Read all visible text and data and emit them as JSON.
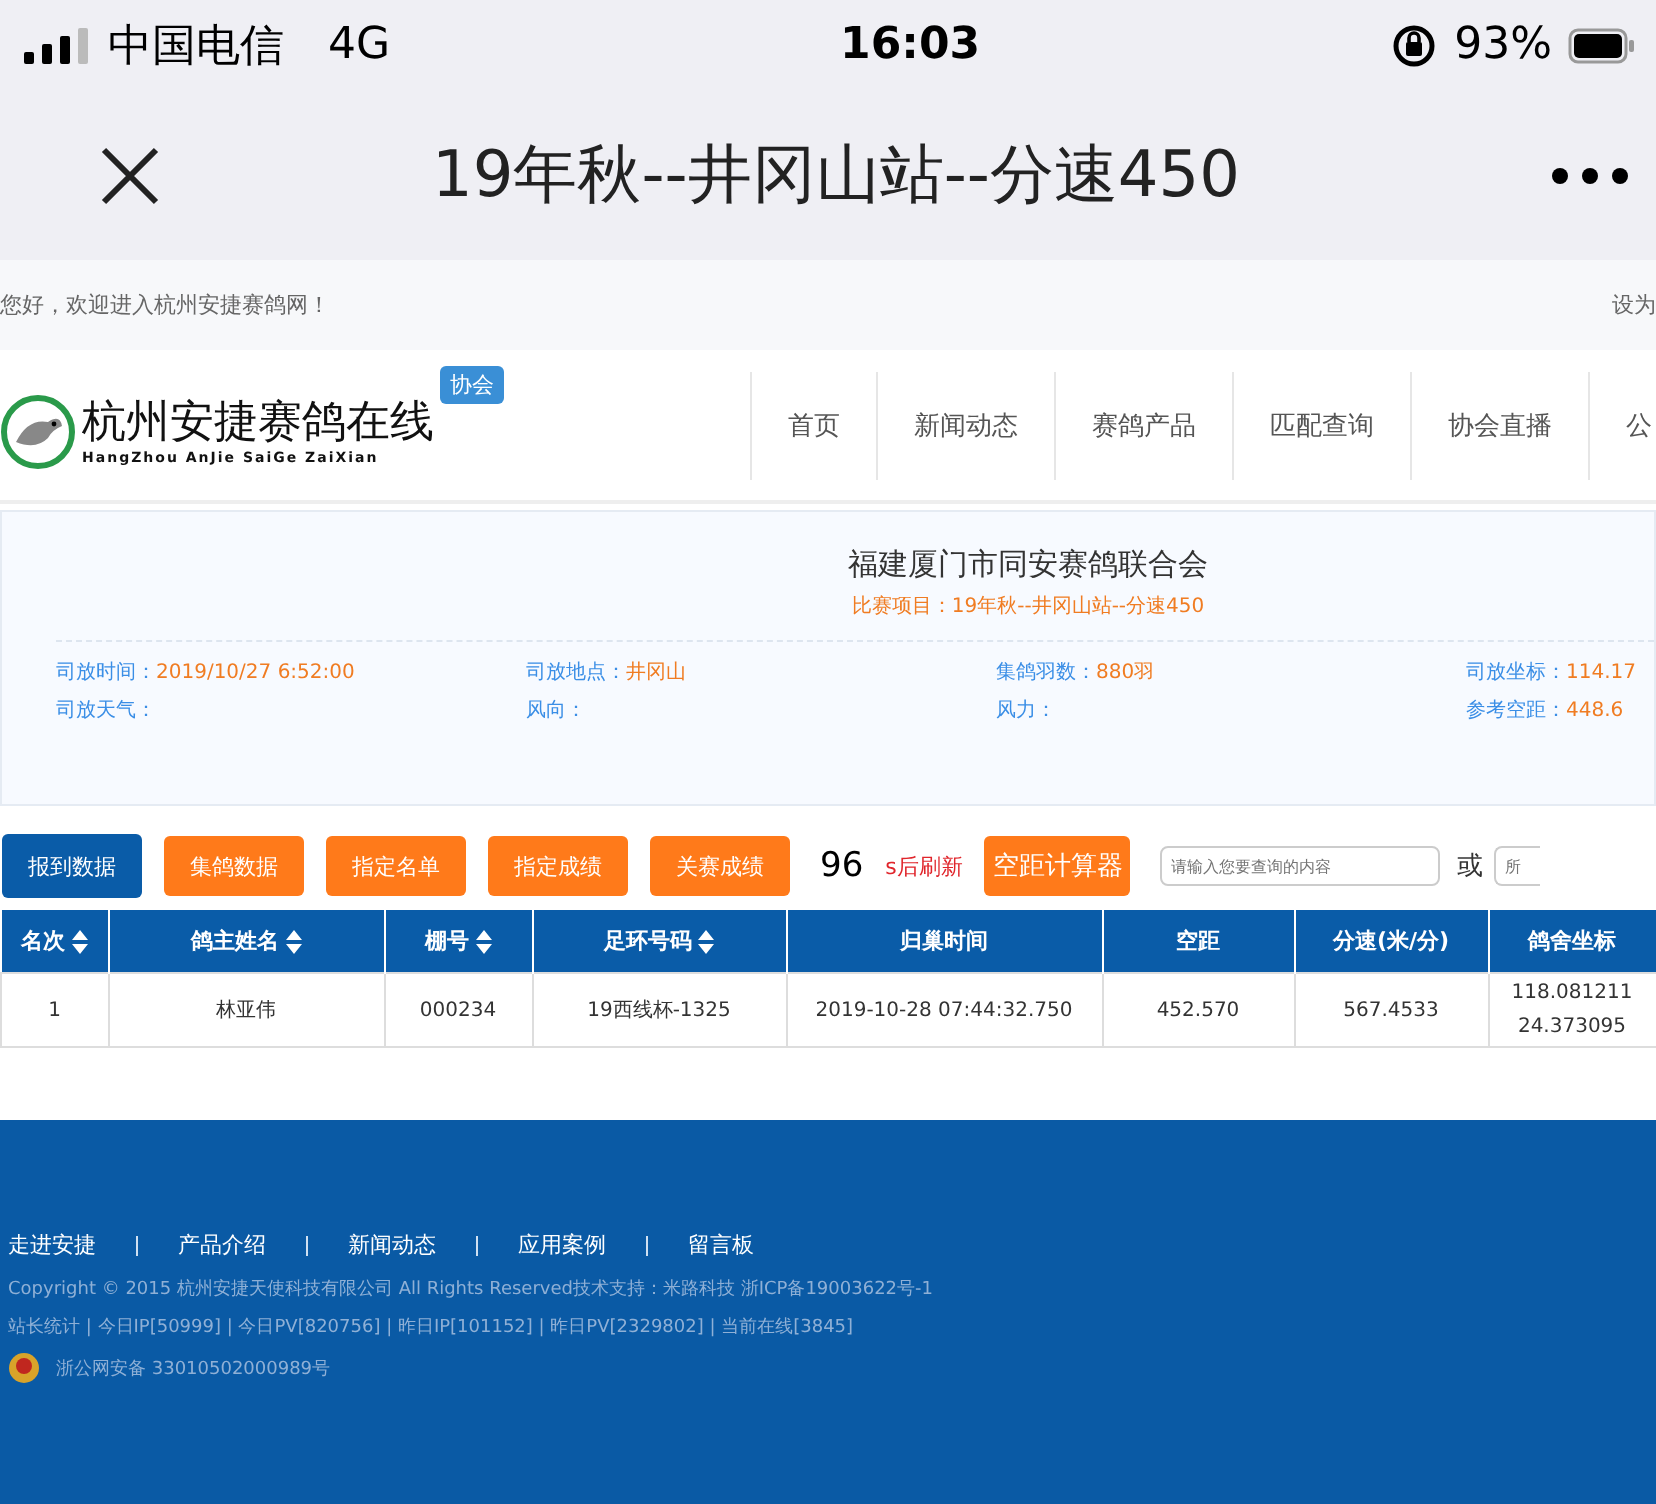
{
  "status_bar": {
    "carrier": "中国电信",
    "network": "4G",
    "time": "16:03",
    "battery": "93%"
  },
  "nav_bar": {
    "title": "19年秋--井冈山站--分速450"
  },
  "top_strip": {
    "greeting": "您好，欢迎进入杭州安捷赛鸽网！",
    "right_link": "设为"
  },
  "header": {
    "logo_title": "杭州安捷赛鸽在线",
    "logo_subtitle": "HangZhou AnJie SaiGe ZaiXian",
    "badge": "协会",
    "nav_items": [
      "首页",
      "新闻动态",
      "赛鸽产品",
      "匹配查询",
      "协会直播",
      "公"
    ]
  },
  "race_panel": {
    "organization": "福建厦门市同安赛鸽联合会",
    "project": "比赛项目：19年秋--井冈山站--分速450",
    "fields": [
      {
        "label": "司放时间：",
        "value": "2019/10/27 6:52:00"
      },
      {
        "label": "司放地点：",
        "value": "井冈山"
      },
      {
        "label": "集鸽羽数：",
        "value": "880羽"
      },
      {
        "label": "司放坐标：",
        "value": "114.17"
      },
      {
        "label": "司放天气："
      },
      {
        "label": "风向："
      },
      {
        "label": "风力："
      },
      {
        "label": "参考空距：",
        "value": "448.6"
      }
    ]
  },
  "toolbar": {
    "tabs": [
      {
        "label": "报到数据",
        "selected": true
      },
      {
        "label": "集鸽数据",
        "selected": false
      },
      {
        "label": "指定名单",
        "selected": false
      },
      {
        "label": "指定成绩",
        "selected": false
      },
      {
        "label": "关赛成绩",
        "selected": false
      }
    ],
    "countdown": "96",
    "countdown_suffix": "s后刷新",
    "calc_button": "空距计算器",
    "search": {
      "placeholder": "请输入您要查询的内容"
    },
    "or_label": "或",
    "search_2": {
      "placeholder": "所"
    }
  },
  "table": {
    "columns": [
      {
        "label": "名次",
        "sortable": true
      },
      {
        "label": "鸽主姓名",
        "sortable": true
      },
      {
        "label": "棚号",
        "sortable": true
      },
      {
        "label": "足环号码",
        "sortable": true
      },
      {
        "label": "归巢时间",
        "sortable": false
      },
      {
        "label": "空距",
        "sortable": false
      },
      {
        "label": "分速(米/分)",
        "sortable": false
      },
      {
        "label": "鸽舍坐标",
        "sortable": false
      }
    ],
    "rows": [
      [
        "1",
        "林亚伟",
        "000234",
        "19西线杯-1325",
        "2019-10-28 07:44:32.750",
        "452.570",
        "567.4533",
        "118.081211\n24.373095"
      ]
    ]
  },
  "footer": {
    "links": [
      "走进安捷",
      "产品介绍",
      "新闻动态",
      "应用案例",
      "留言板"
    ],
    "copyright": "Copyright © 2015 杭州安捷天使科技有限公司 All Rights Reserved技术支持：米路科技 浙ICP备19003622号-1",
    "stats": "站长统计 | 今日IP[50999] | 今日PV[820756] | 昨日IP[101152] | 昨日PV[2329802] | 当前在线[3845]",
    "police_record": "浙公网安备 33010502000989号"
  }
}
